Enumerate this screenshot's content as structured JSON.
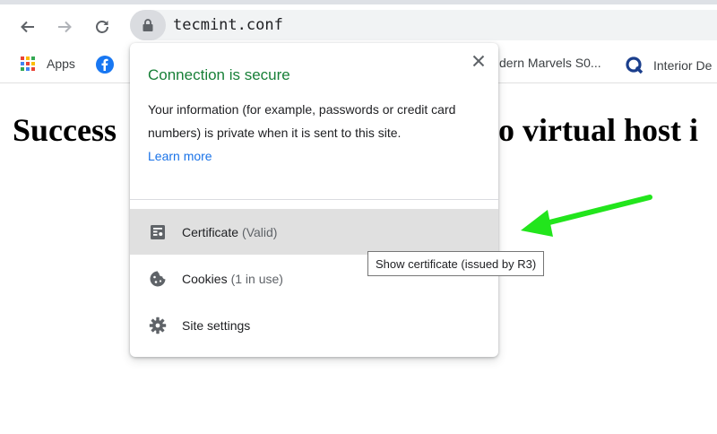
{
  "browser": {
    "url": "tecmint.conf",
    "icons": {
      "back": "arrow-left-icon",
      "forward": "arrow-right-icon",
      "reload": "reload-icon",
      "lock": "lock-icon"
    }
  },
  "bookmarks": {
    "apps_label": "Apps",
    "item2_label": "dern Marvels S0...",
    "item3_label": "Interior De"
  },
  "page": {
    "heading_left": "Success",
    "heading_right": "o virtual host i"
  },
  "popup": {
    "title": "Connection is secure",
    "body": "Your information (for example, passwords or credit card numbers) is private when it is sent to this site.",
    "learn_more": "Learn more",
    "items": [
      {
        "label": "Certificate",
        "sub": "(Valid)",
        "icon": "certificate-icon"
      },
      {
        "label": "Cookies",
        "sub": "(1 in use)",
        "icon": "cookie-icon"
      },
      {
        "label": "Site settings",
        "sub": "",
        "icon": "gear-icon"
      }
    ]
  },
  "tooltip": {
    "text": "Show certificate (issued by R3)"
  },
  "colors": {
    "secure_green": "#188038",
    "link_blue": "#1a73e8",
    "annotation_arrow": "#22e51c"
  }
}
